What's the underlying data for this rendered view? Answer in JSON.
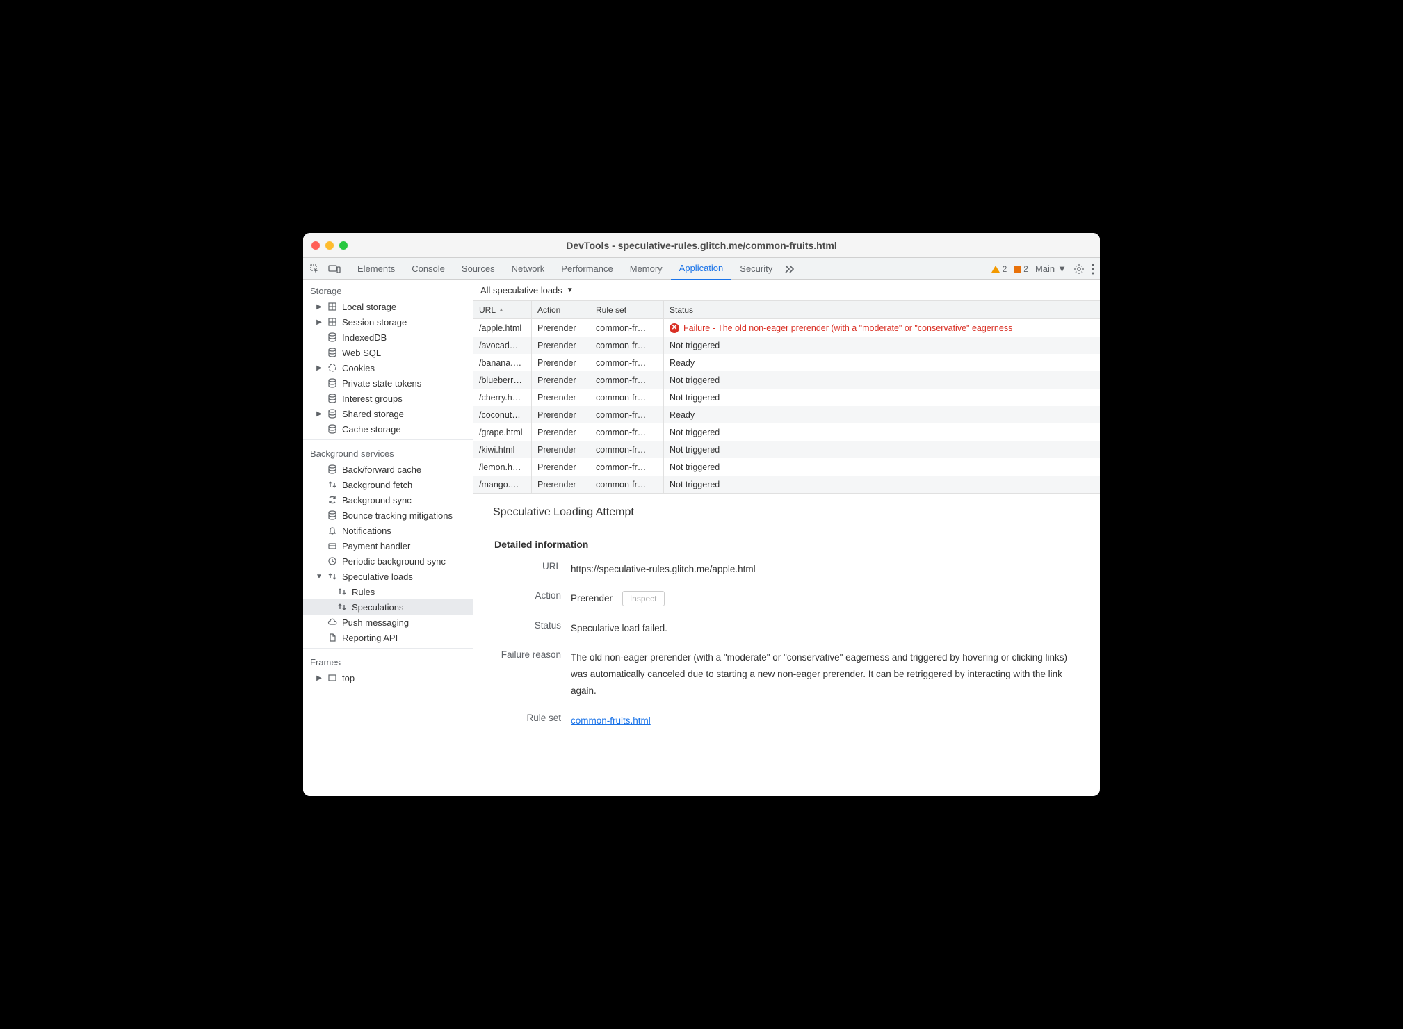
{
  "window_title": "DevTools - speculative-rules.glitch.me/common-fruits.html",
  "toolbar": {
    "tabs": [
      "Elements",
      "Console",
      "Sources",
      "Network",
      "Performance",
      "Memory",
      "Application",
      "Security"
    ],
    "active_tab": "Application",
    "warning_count": "2",
    "error_count": "2",
    "target_label": "Main"
  },
  "sidebar": {
    "storage": {
      "title": "Storage",
      "items": [
        {
          "label": "Local storage",
          "icon": "db-grid",
          "expandable": true
        },
        {
          "label": "Session storage",
          "icon": "db-grid",
          "expandable": true
        },
        {
          "label": "IndexedDB",
          "icon": "db"
        },
        {
          "label": "Web SQL",
          "icon": "db"
        },
        {
          "label": "Cookies",
          "icon": "cookie",
          "expandable": true
        },
        {
          "label": "Private state tokens",
          "icon": "db"
        },
        {
          "label": "Interest groups",
          "icon": "db"
        },
        {
          "label": "Shared storage",
          "icon": "db",
          "expandable": true
        },
        {
          "label": "Cache storage",
          "icon": "db"
        }
      ]
    },
    "background": {
      "title": "Background services",
      "items": [
        {
          "label": "Back/forward cache",
          "icon": "db"
        },
        {
          "label": "Background fetch",
          "icon": "updown"
        },
        {
          "label": "Background sync",
          "icon": "sync"
        },
        {
          "label": "Bounce tracking mitigations",
          "icon": "db"
        },
        {
          "label": "Notifications",
          "icon": "bell"
        },
        {
          "label": "Payment handler",
          "icon": "card"
        },
        {
          "label": "Periodic background sync",
          "icon": "clock"
        },
        {
          "label": "Speculative loads",
          "icon": "updown",
          "expandable": true,
          "expanded": true
        },
        {
          "label": "Rules",
          "icon": "updown",
          "child": true
        },
        {
          "label": "Speculations",
          "icon": "updown",
          "child": true,
          "selected": true
        },
        {
          "label": "Push messaging",
          "icon": "cloud"
        },
        {
          "label": "Reporting API",
          "icon": "file"
        }
      ]
    },
    "frames": {
      "title": "Frames",
      "items": [
        {
          "label": "top",
          "icon": "frame",
          "expandable": true
        }
      ]
    }
  },
  "filter_label": "All speculative loads",
  "table": {
    "headers": {
      "url": "URL",
      "action": "Action",
      "ruleset": "Rule set",
      "status": "Status"
    },
    "rows": [
      {
        "url": "/apple.html",
        "action": "Prerender",
        "ruleset": "common-fr…",
        "status": "Failure - The old non-eager prerender (with a \"moderate\" or \"conservative\" eagerness",
        "fail": true
      },
      {
        "url": "/avocad…",
        "action": "Prerender",
        "ruleset": "common-fr…",
        "status": "Not triggered"
      },
      {
        "url": "/banana.…",
        "action": "Prerender",
        "ruleset": "common-fr…",
        "status": "Ready"
      },
      {
        "url": "/blueberr…",
        "action": "Prerender",
        "ruleset": "common-fr…",
        "status": "Not triggered"
      },
      {
        "url": "/cherry.h…",
        "action": "Prerender",
        "ruleset": "common-fr…",
        "status": "Not triggered"
      },
      {
        "url": "/coconut…",
        "action": "Prerender",
        "ruleset": "common-fr…",
        "status": "Ready"
      },
      {
        "url": "/grape.html",
        "action": "Prerender",
        "ruleset": "common-fr…",
        "status": "Not triggered"
      },
      {
        "url": "/kiwi.html",
        "action": "Prerender",
        "ruleset": "common-fr…",
        "status": "Not triggered"
      },
      {
        "url": "/lemon.h…",
        "action": "Prerender",
        "ruleset": "common-fr…",
        "status": "Not triggered"
      },
      {
        "url": "/mango.…",
        "action": "Prerender",
        "ruleset": "common-fr…",
        "status": "Not triggered"
      }
    ]
  },
  "detail": {
    "title": "Speculative Loading Attempt",
    "section_title": "Detailed information",
    "url_label": "URL",
    "url_value": "https://speculative-rules.glitch.me/apple.html",
    "action_label": "Action",
    "action_value": "Prerender",
    "inspect_label": "Inspect",
    "status_label": "Status",
    "status_value": "Speculative load failed.",
    "reason_label": "Failure reason",
    "reason_value": "The old non-eager prerender (with a \"moderate\" or \"conservative\" eagerness and triggered by hovering or clicking links) was automatically canceled due to starting a new non-eager prerender. It can be retriggered by interacting with the link again.",
    "ruleset_label": "Rule set",
    "ruleset_value": "common-fruits.html"
  }
}
